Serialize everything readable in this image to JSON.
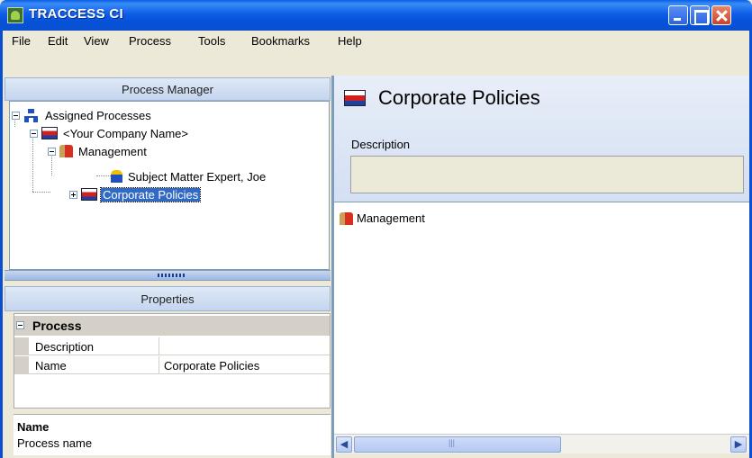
{
  "window": {
    "title": "TRACCESS CI"
  },
  "menu": [
    "File",
    "Edit",
    "View",
    "Process",
    "Tools",
    "Bookmarks",
    "Help"
  ],
  "process_manager": {
    "title": "Process Manager",
    "tree": [
      {
        "label": "Assigned Processes",
        "icon": "org-chart-icon"
      },
      {
        "label": "<Your Company Name>",
        "icon": "company-icon"
      },
      {
        "label": "Management",
        "icon": "people-icon"
      },
      {
        "label": "Subject Matter Expert, Joe",
        "icon": "person-icon"
      },
      {
        "label": "Corporate Policies",
        "icon": "policies-icon",
        "selected": true
      }
    ]
  },
  "properties": {
    "title": "Properties",
    "category": "Process",
    "rows": [
      {
        "key": "Description",
        "value": ""
      },
      {
        "key": "Name",
        "value": "Corporate Policies"
      }
    ],
    "help_title": "Name",
    "help_text": "Process name"
  },
  "detail": {
    "title": "Corporate Policies",
    "description_label": "Description",
    "description_value": "",
    "items": [
      {
        "label": "Management",
        "icon": "people-icon"
      }
    ]
  }
}
